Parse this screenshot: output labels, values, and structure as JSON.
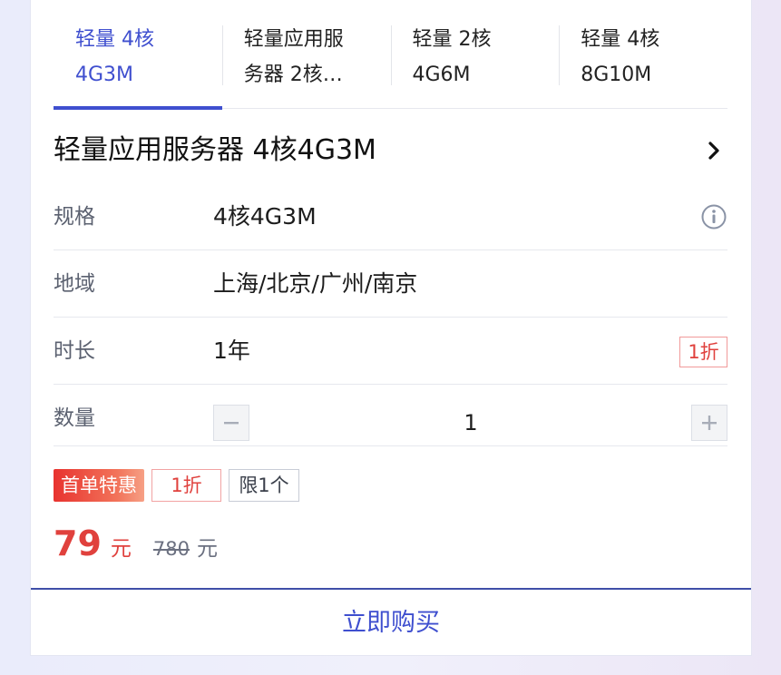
{
  "tabs": [
    {
      "line1": "轻量 4核",
      "line2": "4G3M",
      "active": true
    },
    {
      "line1": "轻量应用服",
      "line2": "务器 2核…",
      "active": false
    },
    {
      "line1": "轻量 2核",
      "line2": "4G6M",
      "active": false
    },
    {
      "line1": "轻量 4核",
      "line2": "8G10M",
      "active": false
    }
  ],
  "product": {
    "title": "轻量应用服务器 4核4G3M",
    "arrow_icon": "chevron-right-icon"
  },
  "spec": {
    "label": "规格",
    "value": "4核4G3M",
    "icon": "info-icon"
  },
  "region": {
    "label": "地域",
    "value": "上海/北京/广州/南京"
  },
  "duration": {
    "label": "时长",
    "value": "1年",
    "badge": "1折"
  },
  "quantity": {
    "label": "数量",
    "value": "1",
    "minus_icon": "minus-icon",
    "plus_icon": "plus-icon"
  },
  "tags": {
    "hot": "首单特惠",
    "discount": "1折",
    "limit": "限1个"
  },
  "price": {
    "amount": "79",
    "unit": "元",
    "original": "780",
    "original_unit": "元"
  },
  "buy": {
    "label": "立即购买"
  },
  "colors": {
    "accent": "#3f4fcf",
    "price_red": "#e0413d",
    "tag_gradient_start": "#e8332f"
  }
}
